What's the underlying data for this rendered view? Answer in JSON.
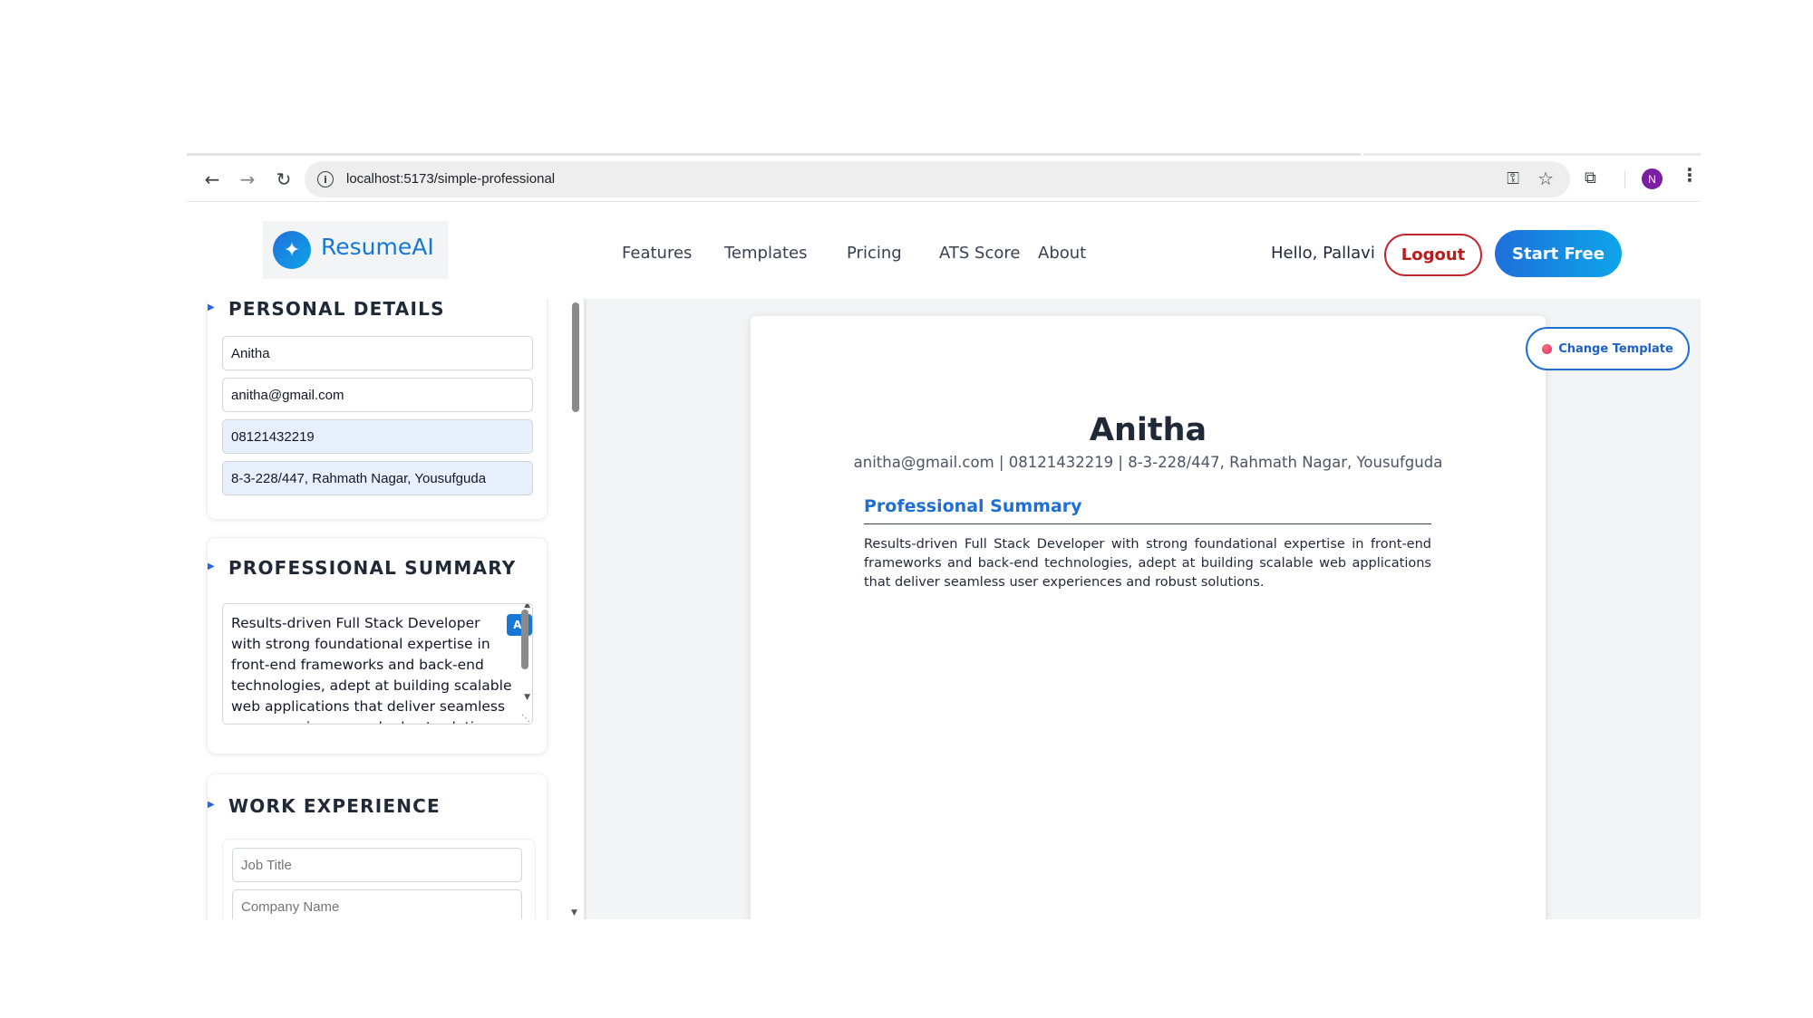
{
  "browser": {
    "url": "localhost:5173/simple-professional",
    "profile_initial": "N"
  },
  "header": {
    "logo_text": "ResumeAI",
    "nav": [
      "Features",
      "Templates",
      "Pricing",
      "ATS Score",
      "About"
    ],
    "greeting": "Hello, Pallavi",
    "logout_label": "Logout",
    "start_label": "Start Free"
  },
  "editor": {
    "personal": {
      "title": "PERSONAL DETAILS",
      "name": "Anitha",
      "email": "anitha@gmail.com",
      "phone": "08121432219",
      "address": "8-3-228/447, Rahmath Nagar, Yousufguda"
    },
    "summary": {
      "title": "PROFESSIONAL SUMMARY",
      "text": "Results-driven Full Stack Developer with strong foundational expertise in front-end frameworks and back-end technologies, adept at building scalable web applications that deliver seamless user experiences and robust solutions.",
      "ai_label": "AI"
    },
    "work": {
      "title": "WORK EXPERIENCE",
      "job_title_placeholder": "Job Title",
      "company_placeholder": "Company Name"
    }
  },
  "preview": {
    "change_template_label": "Change Template",
    "name": "Anitha",
    "contact": "anitha@gmail.com | 08121432219 | 8-3-228/447, Rahmath Nagar, Yousufguda",
    "section_title": "Professional Summary",
    "summary": "Results-driven Full Stack Developer with strong foundational expertise in front-end frameworks and back-end technologies, adept at building scalable web applications that deliver seamless user experiences and robust solutions."
  },
  "colors": {
    "brand_blue": "#1677d6",
    "logout_red": "#c0262d",
    "profile_purple": "#7b1fa2"
  }
}
